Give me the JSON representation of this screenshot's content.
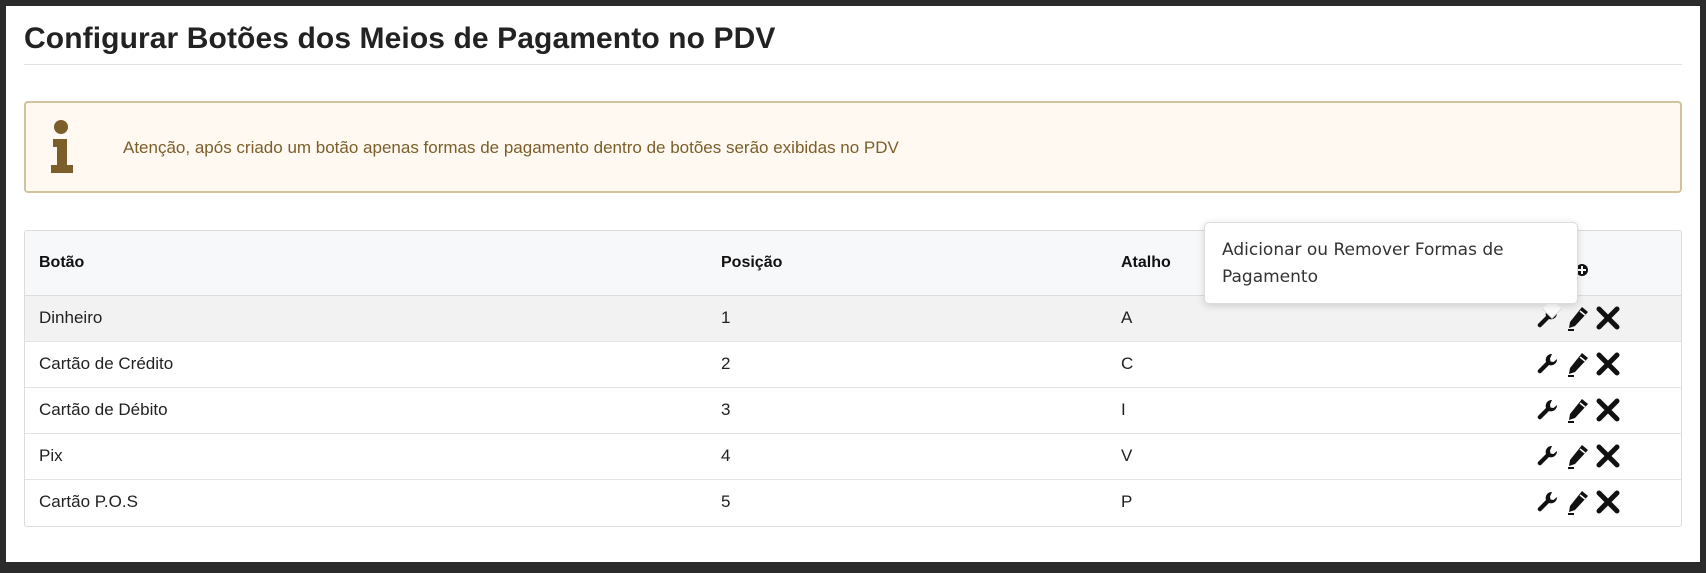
{
  "page": {
    "title": "Configurar Botões dos Meios de Pagamento no PDV"
  },
  "alert": {
    "icon": "info-icon",
    "text": "Atenção, após criado um botão apenas formas de pagamento dentro de botões serão exibidas no PDV"
  },
  "table": {
    "headers": [
      "Botão",
      "Posição",
      "Atalho"
    ],
    "header_action_icon": "add-button-icon",
    "rows": [
      {
        "botao": "Dinheiro",
        "posicao": "1",
        "atalho": "A"
      },
      {
        "botao": "Cartão de Crédito",
        "posicao": "2",
        "atalho": "C"
      },
      {
        "botao": "Cartão de Débito",
        "posicao": "3",
        "atalho": "I"
      },
      {
        "botao": "Pix",
        "posicao": "4",
        "atalho": "V"
      },
      {
        "botao": "Cartão P.O.S",
        "posicao": "5",
        "atalho": "P"
      }
    ],
    "row_action_icons": [
      "wrench-icon",
      "pencil-icon",
      "delete-x-icon"
    ]
  },
  "tooltip": {
    "line1": "Adicionar ou Remover Formas de",
    "line2": "Pagamento"
  },
  "colors": {
    "alert_background": "#fff9f2",
    "alert_border": "#d2c39c",
    "alert_text": "#7b5e2a",
    "alert_icon": "#7b5e2a"
  }
}
